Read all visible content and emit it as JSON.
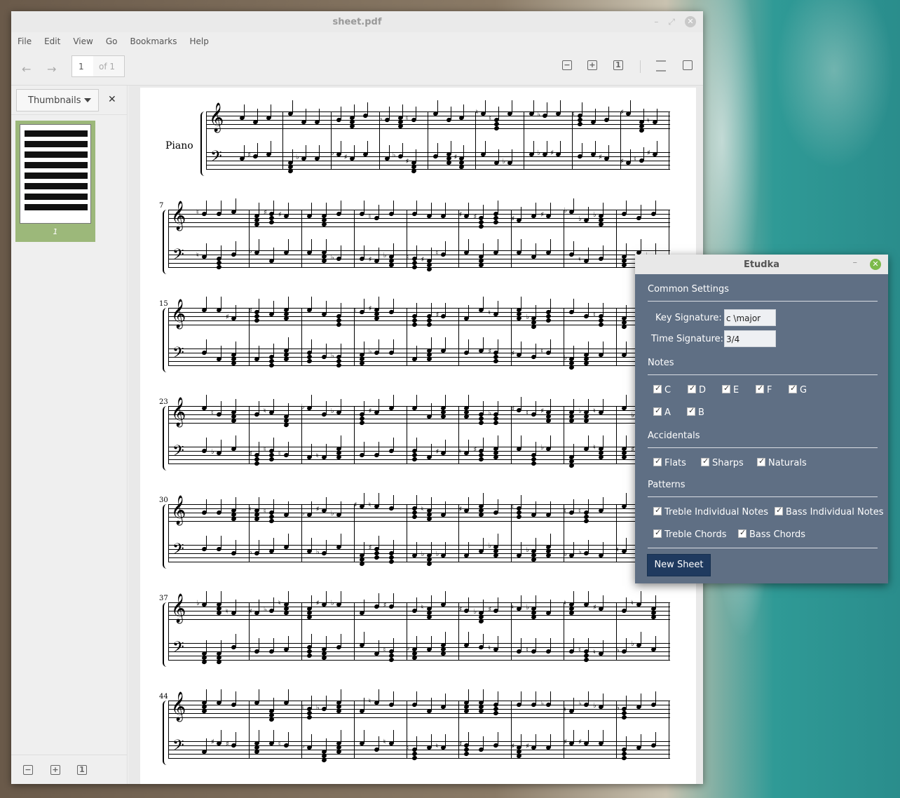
{
  "viewer": {
    "title": "sheet.pdf",
    "menu": [
      "File",
      "Edit",
      "View",
      "Go",
      "Bookmarks",
      "Help"
    ],
    "page_input": "1",
    "page_total": "of 1",
    "sidebar_mode": "Thumbnails",
    "thumbnail_page": "1",
    "score_instrument": "Piano",
    "measure_numbers": [
      "7",
      "15",
      "23",
      "30",
      "37",
      "44"
    ]
  },
  "etudka": {
    "title": "Etudka",
    "common_settings": "Common Settings",
    "key_signature_label": "Key Signature:",
    "key_signature_value": "c \\major",
    "time_signature_label": "Time Signature:",
    "time_signature_value": "3/4",
    "notes_heading": "Notes",
    "notes": [
      "C",
      "D",
      "E",
      "F",
      "G",
      "A",
      "B"
    ],
    "accidentals_heading": "Accidentals",
    "accidentals": [
      "Flats",
      "Sharps",
      "Naturals"
    ],
    "patterns_heading": "Patterns",
    "patterns": [
      "Treble Individual Notes",
      "Bass Individual Notes",
      "Treble Chords",
      "Bass Chords"
    ],
    "new_sheet": "New Sheet"
  },
  "colors": {
    "dialog_bg": "#5f6f84",
    "button_bg": "#1f3a5f",
    "thumb_selected": "#9cb87a",
    "close_green": "#7cba4a"
  }
}
